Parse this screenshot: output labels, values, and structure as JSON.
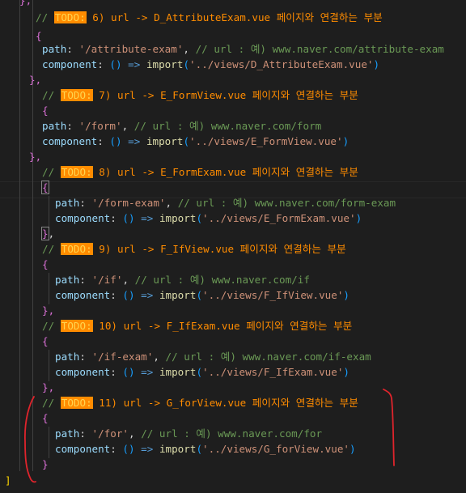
{
  "editor": {
    "lines": [
      {
        "id": "l0",
        "segments": [
          [
            "},",
            "b-purple"
          ]
        ]
      },
      {
        "id": "l1",
        "segments": [
          [
            "// ",
            "c-comment"
          ],
          [
            "TODO:",
            "c-todo"
          ],
          [
            " 6) url -> D_AttributeExam.vue 페이지와 연결하는 부분",
            "c-todo-text"
          ]
        ]
      },
      {
        "id": "l2",
        "segments": [
          [
            "{",
            "b-purple"
          ]
        ]
      },
      {
        "id": "l3",
        "segments": [
          [
            "path",
            "c-key"
          ],
          [
            ": ",
            "c-punc"
          ],
          [
            "'/attribute-exam'",
            "c-str"
          ],
          [
            ", ",
            "c-punc"
          ],
          [
            "// url : 예) www.naver.com/attribute-exam",
            "c-comment"
          ]
        ]
      },
      {
        "id": "l4",
        "segments": [
          [
            "component",
            "c-key"
          ],
          [
            ": ",
            "c-punc"
          ],
          [
            "()",
            "b-blue"
          ],
          [
            " => ",
            "c-kw"
          ],
          [
            "import",
            "c-fn"
          ],
          [
            "(",
            "b-blue"
          ],
          [
            "'../views/D_AttributeExam.vue'",
            "c-str"
          ],
          [
            ")",
            "b-blue"
          ]
        ]
      },
      {
        "id": "l5",
        "segments": [
          [
            "},",
            "b-purple"
          ]
        ]
      },
      {
        "id": "l6",
        "segments": [
          [
            "// ",
            "c-comment"
          ],
          [
            "TODO:",
            "c-todo"
          ],
          [
            " 7) url -> E_FormView.vue 페이지와 연결하는 부분",
            "c-todo-text"
          ]
        ]
      },
      {
        "id": "l7",
        "segments": [
          [
            "{",
            "b-purple"
          ]
        ]
      },
      {
        "id": "l8",
        "segments": [
          [
            "path",
            "c-key"
          ],
          [
            ": ",
            "c-punc"
          ],
          [
            "'/form'",
            "c-str"
          ],
          [
            ", ",
            "c-punc"
          ],
          [
            "// url : 예) www.naver.com/form",
            "c-comment"
          ]
        ]
      },
      {
        "id": "l9",
        "segments": [
          [
            "component",
            "c-key"
          ],
          [
            ": ",
            "c-punc"
          ],
          [
            "()",
            "b-blue"
          ],
          [
            " => ",
            "c-kw"
          ],
          [
            "import",
            "c-fn"
          ],
          [
            "(",
            "b-blue"
          ],
          [
            "'../views/E_FormView.vue'",
            "c-str"
          ],
          [
            ")",
            "b-blue"
          ]
        ]
      },
      {
        "id": "l10",
        "segments": [
          [
            "},",
            "b-purple"
          ]
        ]
      },
      {
        "id": "l11",
        "segments": [
          [
            "// ",
            "c-comment"
          ],
          [
            "TODO:",
            "c-todo"
          ],
          [
            " 8) url -> E_FormExam.vue 페이지와 연결하는 부분",
            "c-todo-text"
          ]
        ]
      },
      {
        "id": "l12",
        "segments": [
          [
            "{",
            "b-purple bracket-box"
          ]
        ]
      },
      {
        "id": "l13",
        "segments": [
          [
            "path",
            "c-key"
          ],
          [
            ": ",
            "c-punc"
          ],
          [
            "'/form-exam'",
            "c-str"
          ],
          [
            ", ",
            "c-punc"
          ],
          [
            "// url : 예) www.naver.com/form-exam",
            "c-comment"
          ]
        ]
      },
      {
        "id": "l14",
        "segments": [
          [
            "component",
            "c-key"
          ],
          [
            ": ",
            "c-punc"
          ],
          [
            "()",
            "b-blue"
          ],
          [
            " => ",
            "c-kw"
          ],
          [
            "import",
            "c-fn"
          ],
          [
            "(",
            "b-blue"
          ],
          [
            "'../views/E_FormExam.vue'",
            "c-str"
          ],
          [
            ")",
            "b-blue"
          ]
        ]
      },
      {
        "id": "l15",
        "segments": [
          [
            "}",
            "b-purple bracket-box"
          ],
          [
            ",",
            "c-punc"
          ]
        ]
      },
      {
        "id": "l16",
        "segments": [
          [
            "// ",
            "c-comment"
          ],
          [
            "TODO:",
            "c-todo"
          ],
          [
            " 9) url -> F_IfView.vue 페이지와 연결하는 부분",
            "c-todo-text"
          ]
        ]
      },
      {
        "id": "l17",
        "segments": [
          [
            "{",
            "b-purple"
          ]
        ]
      },
      {
        "id": "l18",
        "segments": [
          [
            "path",
            "c-key"
          ],
          [
            ": ",
            "c-punc"
          ],
          [
            "'/if'",
            "c-str"
          ],
          [
            ", ",
            "c-punc"
          ],
          [
            "// url : 예) www.naver.com/if",
            "c-comment"
          ]
        ]
      },
      {
        "id": "l19",
        "segments": [
          [
            "component",
            "c-key"
          ],
          [
            ": ",
            "c-punc"
          ],
          [
            "()",
            "b-blue"
          ],
          [
            " => ",
            "c-kw"
          ],
          [
            "import",
            "c-fn"
          ],
          [
            "(",
            "b-blue"
          ],
          [
            "'../views/F_IfView.vue'",
            "c-str"
          ],
          [
            ")",
            "b-blue"
          ]
        ]
      },
      {
        "id": "l20",
        "segments": [
          [
            "},",
            "b-purple"
          ]
        ]
      },
      {
        "id": "l21",
        "segments": [
          [
            "// ",
            "c-comment"
          ],
          [
            "TODO:",
            "c-todo"
          ],
          [
            " 10) url -> F_IfExam.vue 페이지와 연결하는 부분",
            "c-todo-text"
          ]
        ]
      },
      {
        "id": "l22",
        "segments": [
          [
            "{",
            "b-purple"
          ]
        ]
      },
      {
        "id": "l23",
        "segments": [
          [
            "path",
            "c-key"
          ],
          [
            ": ",
            "c-punc"
          ],
          [
            "'/if-exam'",
            "c-str"
          ],
          [
            ", ",
            "c-punc"
          ],
          [
            "// url : 예) www.naver.com/if-exam",
            "c-comment"
          ]
        ]
      },
      {
        "id": "l24",
        "segments": [
          [
            "component",
            "c-key"
          ],
          [
            ": ",
            "c-punc"
          ],
          [
            "()",
            "b-blue"
          ],
          [
            " => ",
            "c-kw"
          ],
          [
            "import",
            "c-fn"
          ],
          [
            "(",
            "b-blue"
          ],
          [
            "'../views/F_IfExam.vue'",
            "c-str"
          ],
          [
            ")",
            "b-blue"
          ]
        ]
      },
      {
        "id": "l25",
        "segments": [
          [
            "},",
            "b-purple"
          ]
        ]
      },
      {
        "id": "l26",
        "segments": [
          [
            "// ",
            "c-comment"
          ],
          [
            "TODO:",
            "c-todo"
          ],
          [
            " 11) url -> G_forView.vue 페이지와 연결하는 부분",
            "c-todo-text"
          ]
        ]
      },
      {
        "id": "l27",
        "segments": [
          [
            "{",
            "b-purple"
          ]
        ]
      },
      {
        "id": "l28",
        "segments": [
          [
            "path",
            "c-key"
          ],
          [
            ": ",
            "c-punc"
          ],
          [
            "'/for'",
            "c-str"
          ],
          [
            ", ",
            "c-punc"
          ],
          [
            "// url : 예) www.naver.com/for",
            "c-comment"
          ]
        ]
      },
      {
        "id": "l29",
        "segments": [
          [
            "component",
            "c-key"
          ],
          [
            ": ",
            "c-punc"
          ],
          [
            "()",
            "b-blue"
          ],
          [
            " => ",
            "c-kw"
          ],
          [
            "import",
            "c-fn"
          ],
          [
            "(",
            "b-blue"
          ],
          [
            "'../views/G_forView.vue'",
            "c-str"
          ],
          [
            ")",
            "b-blue"
          ]
        ]
      },
      {
        "id": "l30",
        "segments": [
          [
            "}",
            "b-purple"
          ]
        ]
      },
      {
        "id": "l31",
        "segments": [
          [
            "]",
            "b-gold"
          ]
        ]
      }
    ]
  },
  "annotation": {
    "description": "red hand-drawn bracket marks around entry 11",
    "color": "#e0242c"
  }
}
